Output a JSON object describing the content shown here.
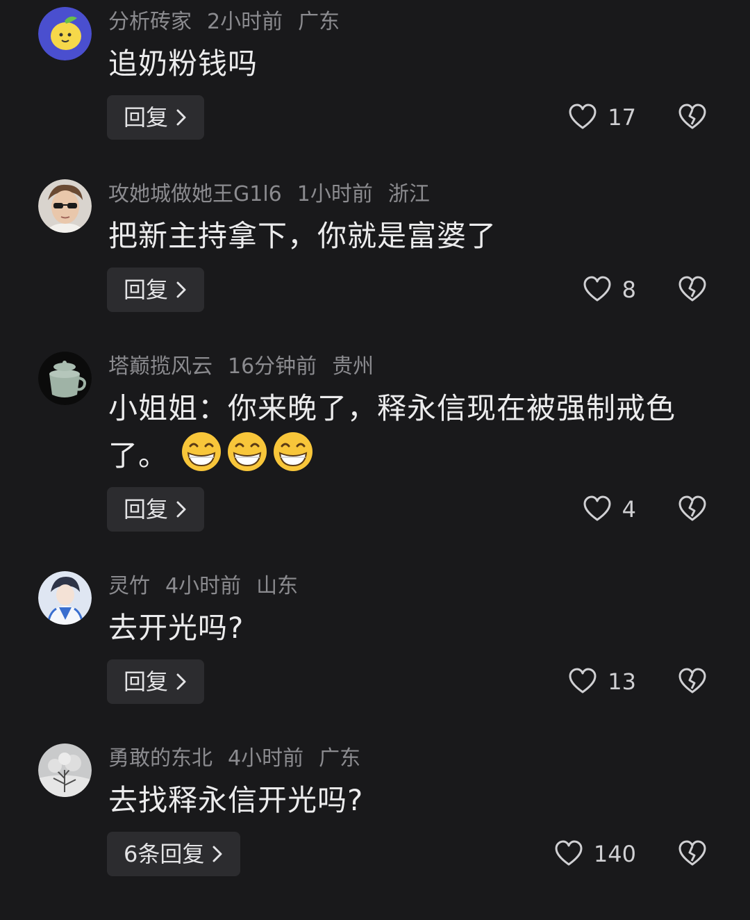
{
  "comments": [
    {
      "username": "分析砖家",
      "time": "2小时前",
      "location": "广东",
      "text": "追奶粉钱吗",
      "reply_label": "回复",
      "likes": "17",
      "avatar": "lemon-avatar"
    },
    {
      "username": "攻她城做她王G1l6",
      "time": "1小时前",
      "location": "浙江",
      "text": "把新主持拿下，你就是富婆了",
      "reply_label": "回复",
      "likes": "8",
      "avatar": "man-sunglasses-avatar"
    },
    {
      "username": "塔巅揽风云",
      "time": "16分钟前",
      "location": "贵州",
      "text_line1": "小姐姐：你来晚了，释永信现在被强制戒色",
      "text_line2": "了。",
      "emojis": [
        "grinning-face-emoji",
        "grinning-face-emoji",
        "grinning-face-emoji"
      ],
      "reply_label": "回复",
      "likes": "4",
      "avatar": "teacup-avatar"
    },
    {
      "username": "灵竹",
      "time": "4小时前",
      "location": "山东",
      "text": "去开光吗?",
      "reply_label": "回复",
      "likes": "13",
      "avatar": "anime-avatar"
    },
    {
      "username": "勇敢的东北",
      "time": "4小时前",
      "location": "广东",
      "text": "去找释永信开光吗?",
      "reply_label": "6条回复",
      "likes": "140",
      "avatar": "snow-tree-avatar"
    }
  ],
  "colors": {
    "background": "#19191b",
    "meta_text": "#8b8b8f",
    "body_text": "#ececed",
    "button_bg": "#2c2c2f"
  }
}
